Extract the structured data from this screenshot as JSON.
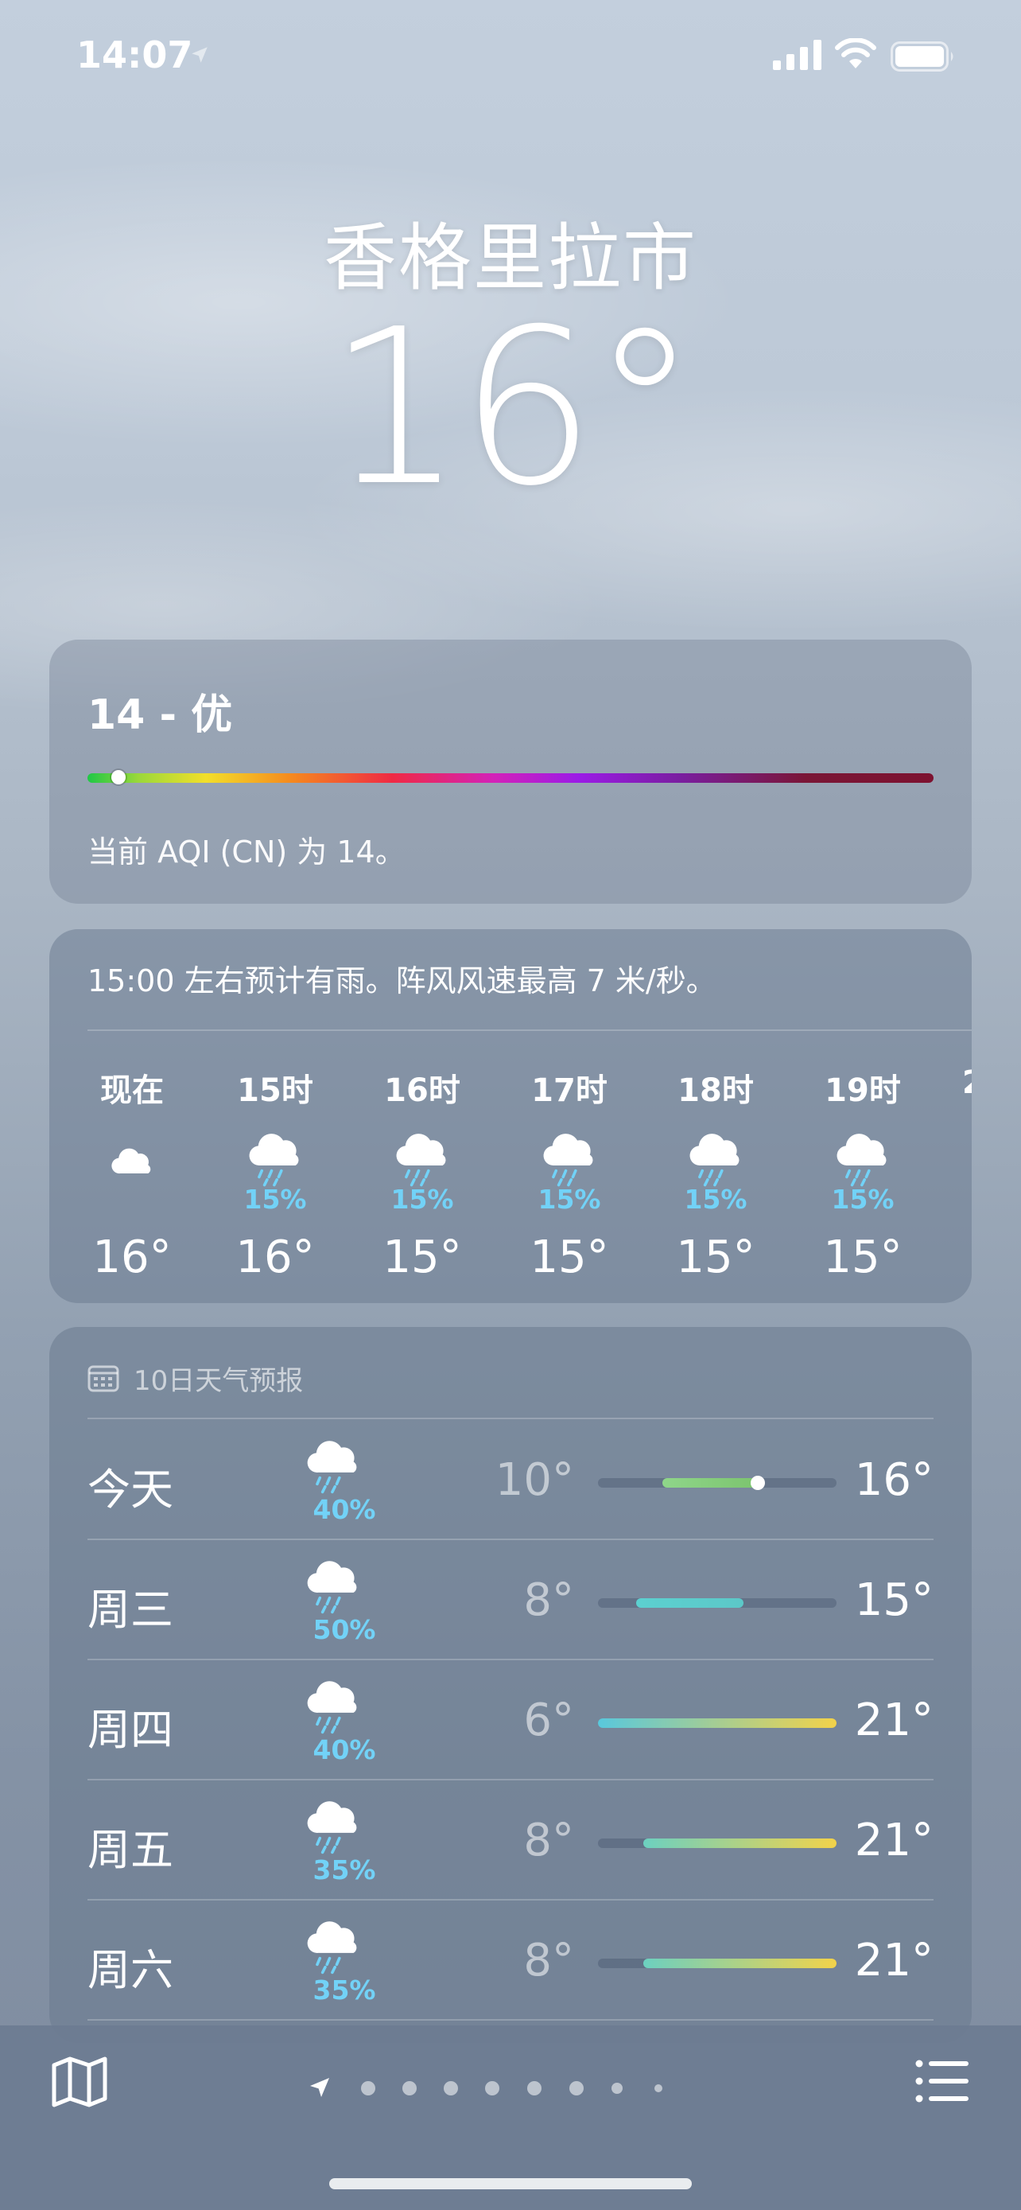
{
  "status": {
    "time": "14:07"
  },
  "header": {
    "city": "香格里拉市",
    "temperature": "16°"
  },
  "aqi": {
    "value": "14 - 优",
    "description": "当前 AQI (CN) 为 14。",
    "level_fraction": 0.02
  },
  "hourly": {
    "note": "15:00 左右预计有雨。阵风风速最高 7 米/秒。",
    "items": [
      {
        "label": "现在",
        "icon": "cloud-icon",
        "pop": "",
        "temp": "16°"
      },
      {
        "label": "15时",
        "icon": "rain-icon",
        "pop": "15%",
        "temp": "16°"
      },
      {
        "label": "16时",
        "icon": "rain-icon",
        "pop": "15%",
        "temp": "15°"
      },
      {
        "label": "17时",
        "icon": "rain-icon",
        "pop": "15%",
        "temp": "15°"
      },
      {
        "label": "18时",
        "icon": "rain-icon",
        "pop": "15%",
        "temp": "15°"
      },
      {
        "label": "19时",
        "icon": "rain-icon",
        "pop": "15%",
        "temp": "15°"
      }
    ]
  },
  "daily": {
    "title": "10日天气预报",
    "days": [
      {
        "name": "今天",
        "icon": "rain-icon",
        "pop": "40%",
        "low": "10°",
        "high": "16°",
        "range": [
          0.27,
          0.67
        ],
        "current": 0.67,
        "colors": [
          "#8fd68a",
          "#7cc46e"
        ]
      },
      {
        "name": "周三",
        "icon": "rain-icon",
        "pop": "50%",
        "low": "8°",
        "high": "15°",
        "range": [
          0.16,
          0.61
        ],
        "current": null,
        "colors": [
          "#5cd0d0",
          "#5cc8c8"
        ]
      },
      {
        "name": "周四",
        "icon": "rain-icon",
        "pop": "40%",
        "low": "6°",
        "high": "21°",
        "range": [
          0.0,
          1.0
        ],
        "current": null,
        "colors": [
          "#59c8dc",
          "#f2d24a"
        ]
      },
      {
        "name": "周五",
        "icon": "rain-icon",
        "pop": "35%",
        "low": "8°",
        "high": "21°",
        "range": [
          0.19,
          1.0
        ],
        "current": null,
        "colors": [
          "#6cd0c0",
          "#f2d24a"
        ]
      },
      {
        "name": "周六",
        "icon": "rain-icon",
        "pop": "35%",
        "low": "8°",
        "high": "21°",
        "range": [
          0.19,
          1.0
        ],
        "current": null,
        "colors": [
          "#6cd0c0",
          "#f2d24a"
        ]
      }
    ]
  },
  "bottom": {
    "page_count": 9,
    "active_page": 0
  }
}
